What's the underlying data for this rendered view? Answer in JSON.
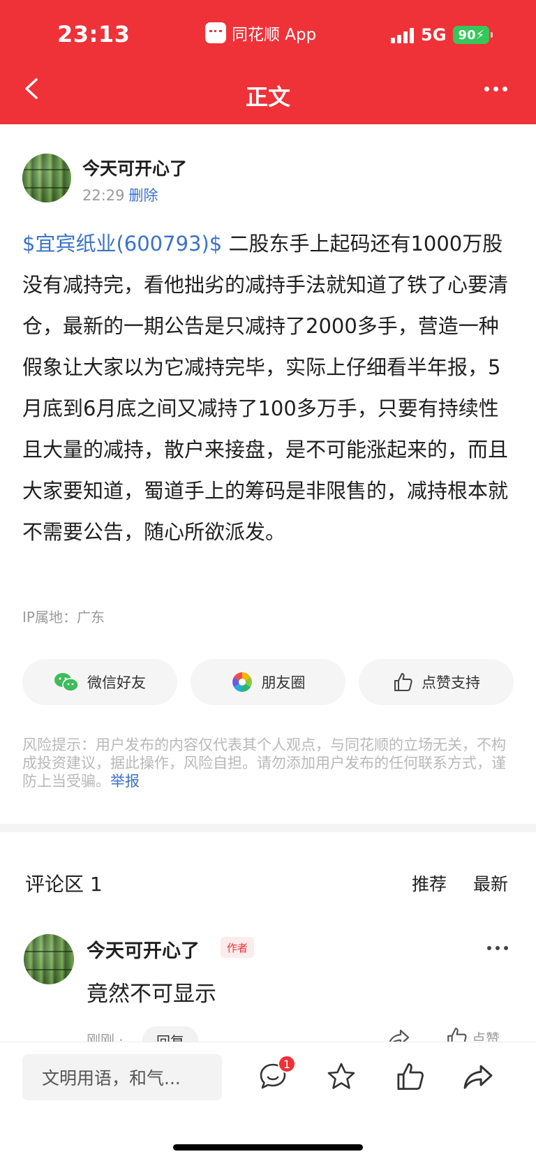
{
  "status_bar": {
    "time": "23:13",
    "app": "同花顺 App",
    "network": "5G",
    "battery": "90"
  },
  "nav": {
    "title": "正文"
  },
  "post": {
    "author": "今天可开心了",
    "time": "22:29",
    "delete_label": "删除",
    "stock_tag": "$宜宾纸业(600793)$",
    "body": " 二股东手上起码还有1000万股没有减持完，看他拙劣的减持手法就知道了铁了心要清仓，最新的一期公告是只减持了2000多手，营造一种假象让大家以为它减持完毕，实际上仔细看半年报，5月底到6月底之间又减持了100多万手，只要有持续性且大量的减持，散户来接盘，是不可能涨起来的，而且大家要知道，蜀道手上的筹码是非限售的，减持根本就不需要公告，随心所欲派发。",
    "ip": "IP属地：广东"
  },
  "share": {
    "wechat": "微信好友",
    "moments": "朋友圈",
    "like": "点赞支持"
  },
  "risk": {
    "text": "风险提示：用户发布的内容仅代表其个人观点，与同花顺的立场无关，不构成投资建议，据此操作，风险自担。请勿添加用户发布的任何联系方式，谨防上当受骗。",
    "report": "举报"
  },
  "comments": {
    "title": "评论区 1",
    "sort_recommend": "推荐",
    "sort_latest": "最新",
    "items": [
      {
        "name": "今天可开心了",
        "tag": "作者",
        "text": "竟然不可显示",
        "time": "刚刚 ·",
        "reply": "回复",
        "like": "点赞"
      }
    ]
  },
  "bottom_bar": {
    "placeholder": "文明用语，和气...",
    "comment_badge": "1"
  },
  "colors": {
    "brand_red": "#ef3138",
    "link_blue": "#3a73c7"
  },
  "icons": [
    "back-icon",
    "more-icon",
    "wechat-icon",
    "moments-icon",
    "thumb-up-icon",
    "comment-icon",
    "star-icon",
    "share-icon"
  ]
}
